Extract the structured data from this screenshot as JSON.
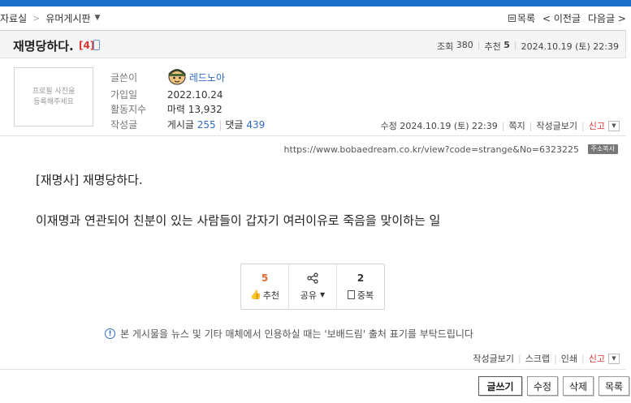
{
  "breadcrumb": {
    "item1": "자료실",
    "separator": ">",
    "item2": "유머게시판"
  },
  "topnav": {
    "list": "목록",
    "prev": "< 이전글",
    "next": "다음글 >"
  },
  "post": {
    "title": "재명당하다.",
    "comment_count": "[4]",
    "stats": {
      "views_label": "조회",
      "views": "380",
      "recommend_label": "추천",
      "recommend": "5",
      "datetime": "2024.10.19 (토) 22:39"
    }
  },
  "profile": {
    "placeholder": "프로필 사진을 등록해주세요"
  },
  "author": {
    "label_writer": "글쓴이",
    "name": "레드노아",
    "label_joined": "가입일",
    "joined": "2022.10.24",
    "label_activity": "활동지수",
    "activity": "마력 13,932",
    "label_posts": "작성글",
    "posts_label": "게시글",
    "posts": "255",
    "comments_label": "댓글",
    "comments": "439"
  },
  "post_actions": {
    "edited": "수정 2024.10.19 (토) 22:39",
    "message": "쪽지",
    "view_posts": "작성글보기",
    "report": "신고"
  },
  "url": {
    "text": "https://www.bobaedream.co.kr/view?code=strange&No=6323225",
    "copy_label": "주소복사"
  },
  "content": {
    "line1": "[재명사] 재명당하다.",
    "line2": "이재명과 연관되어 친분이 있는 사람들이 갑자기 여러이유로 죽음을 맞이하는 일"
  },
  "reactions": {
    "recommend_count": "5",
    "recommend_label": "추천",
    "share_label": "공유",
    "duplicate_count": "2",
    "duplicate_label": "중복"
  },
  "notice": {
    "text": "본 게시물을 뉴스 및 기타 매체에서 인용하실 때는 '보배드림' 출처 표기를 부탁드립니다"
  },
  "footer_actions": {
    "view_posts": "작성글보기",
    "scrap": "스크랩",
    "print": "인쇄",
    "report": "신고"
  },
  "buttons": {
    "write": "글쓰기",
    "edit": "수정",
    "delete": "삭제",
    "list": "목록"
  },
  "colors": {
    "accent": "#1b6fc8",
    "link": "#2e6bc4",
    "red": "#dd3333",
    "orange": "#e8692a"
  }
}
